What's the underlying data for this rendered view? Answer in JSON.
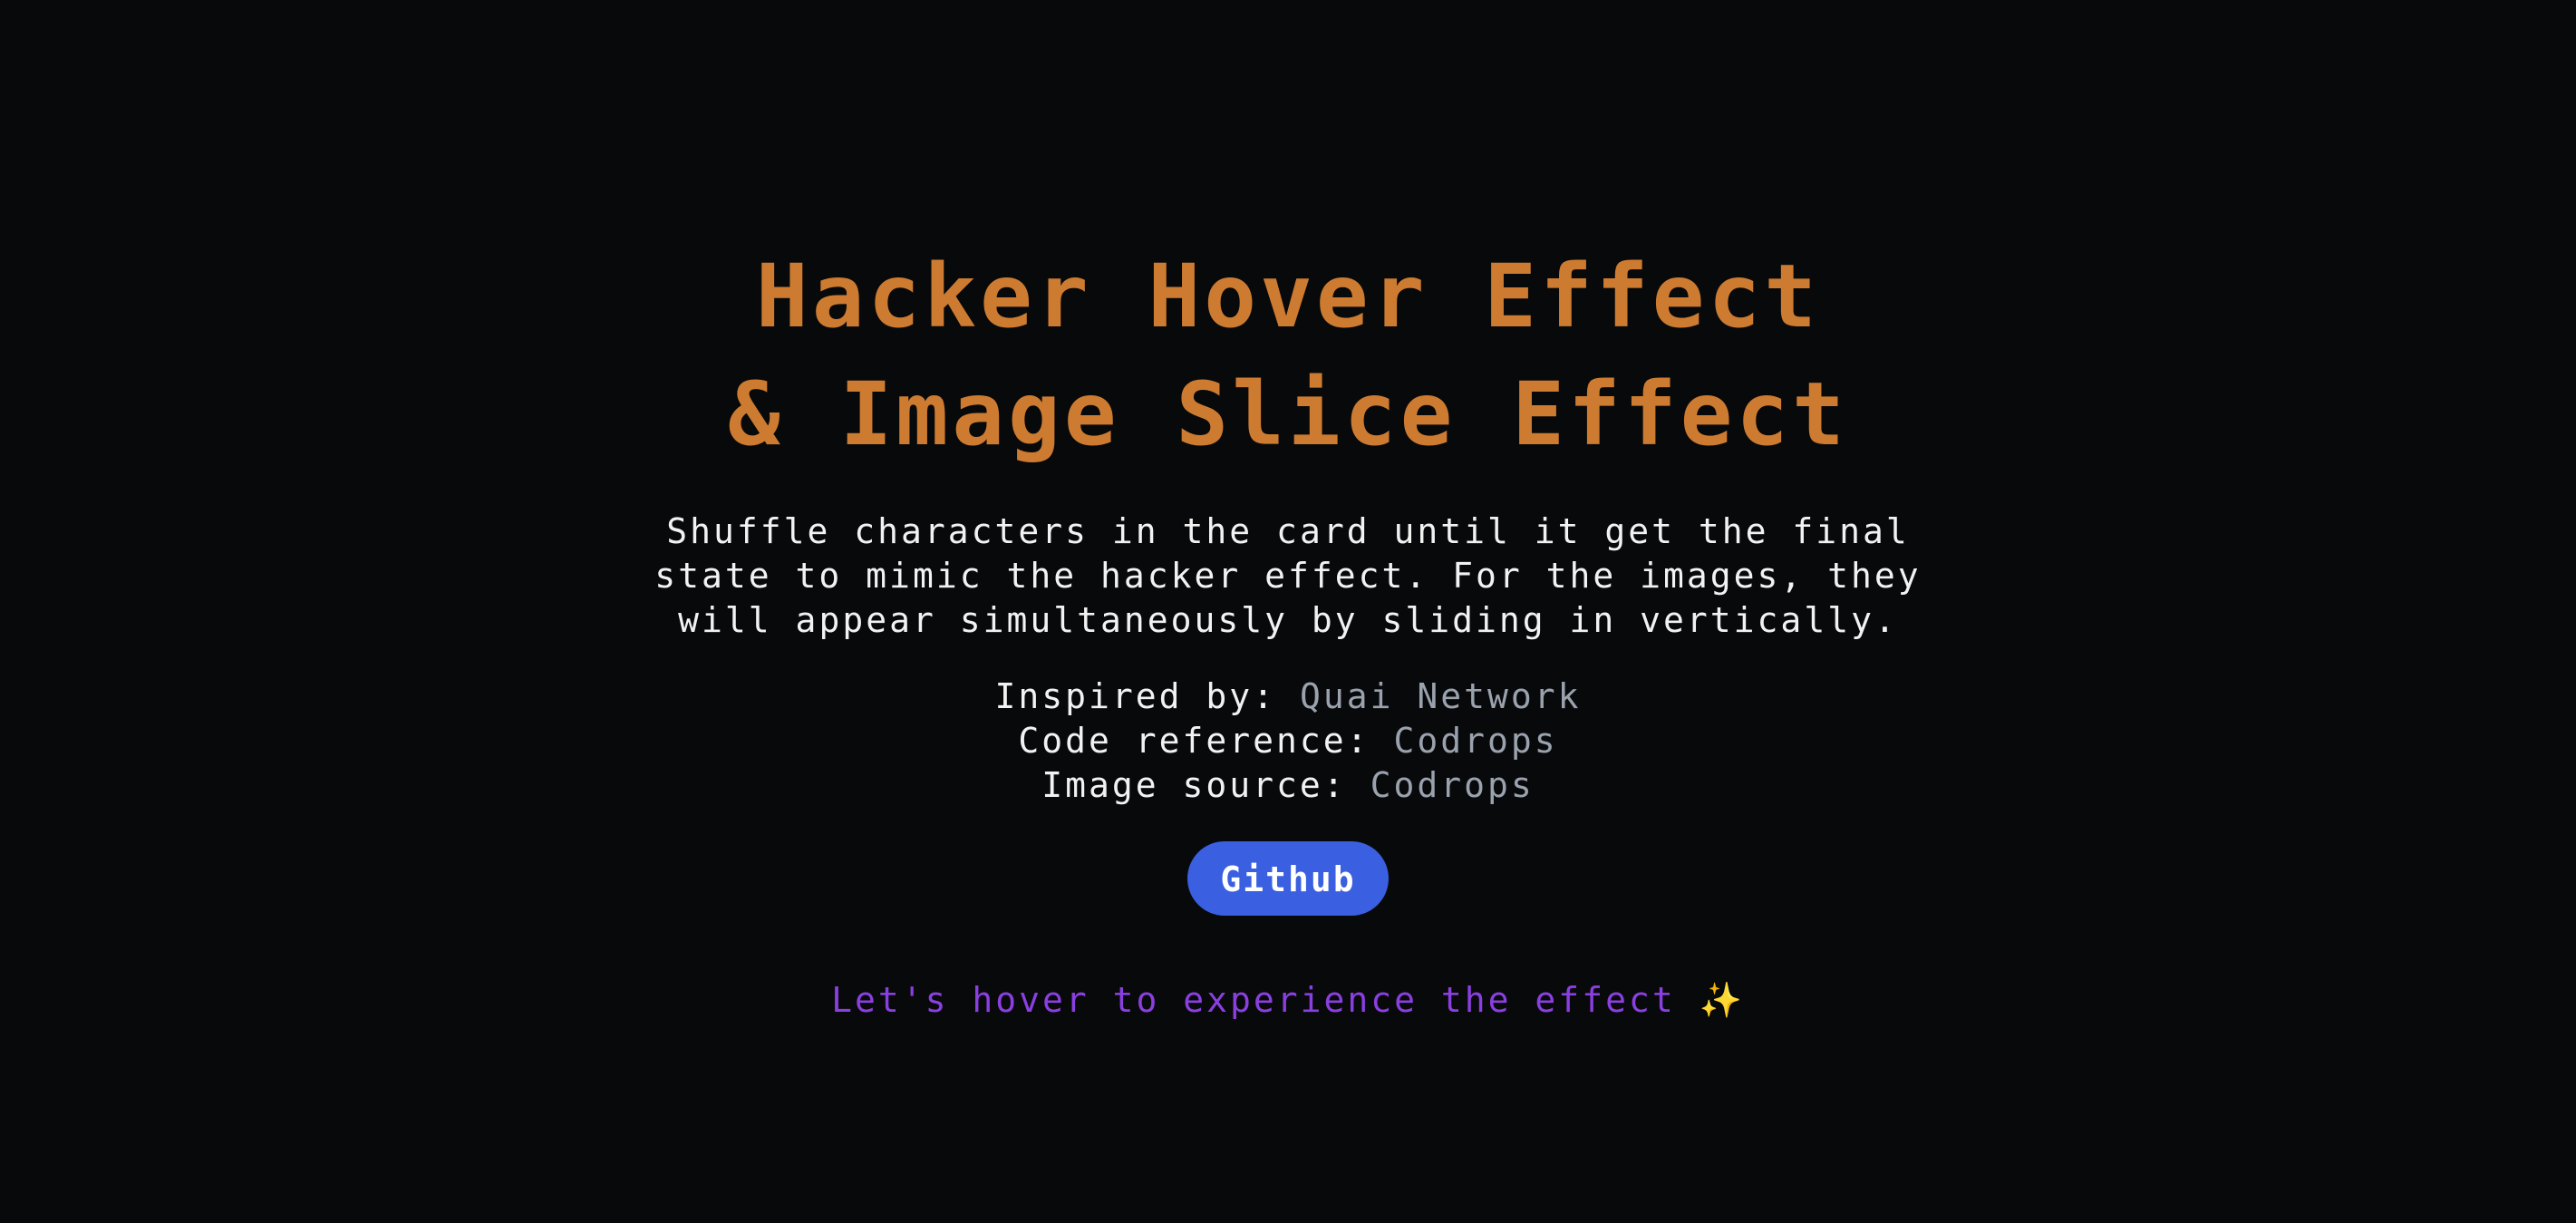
{
  "title": {
    "line1": "Hacker Hover Effect",
    "line2": "& Image Slice Effect"
  },
  "description": {
    "line1": "Shuffle characters in the card until it get the final",
    "line2": "state to mimic the hacker effect. For the images, they",
    "line3": "will appear simultaneously by sliding in vertically."
  },
  "credits": [
    {
      "label": "Inspired by: ",
      "link": "Quai Network"
    },
    {
      "label": "Code reference: ",
      "link": "Codrops"
    },
    {
      "label": "Image source: ",
      "link": "Codrops"
    }
  ],
  "github_button": {
    "label": "Github"
  },
  "hint": {
    "text": "Let's hover to experience the effect ",
    "emoji": "✨"
  },
  "colors": {
    "background": "#08090b",
    "title": "#cd7b31",
    "body_text": "#f2f2f2",
    "link": "#9aa2ad",
    "button": "#3a5fe0",
    "hint": "#8a3fe0"
  }
}
